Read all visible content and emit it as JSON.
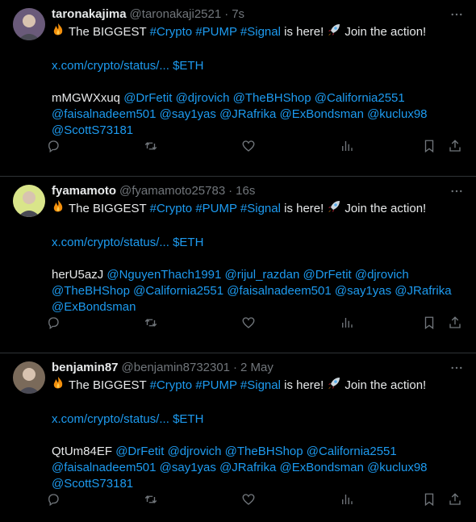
{
  "tweets": [
    {
      "name": "taronakajima",
      "handle": "@taronakaji2521",
      "time": "7s",
      "text_before": "The BIGGEST",
      "tags": [
        "#Crypto",
        "#PUMP",
        "#Signal"
      ],
      "text_after": "is here!",
      "text_end": "Join the action!",
      "link": "x.com/crypto/status/...",
      "cashtag": "$ETH",
      "code": "mMGWXxuq",
      "mentions_line1": "@DrFetit @djrovich @TheBHShop @California2551",
      "mentions_line2": "@faisalnadeem501 @say1yas @JRafrika @ExBondsman @kuclux98",
      "mentions_line3": "@ScottS73181",
      "avatar_color": "#6a5a7a"
    },
    {
      "name": "fyamamoto",
      "handle": "@fyamamoto25783",
      "time": "16s",
      "text_before": "The BIGGEST",
      "tags": [
        "#Crypto",
        "#PUMP",
        "#Signal"
      ],
      "text_after": "is here!",
      "text_end": "Join the action!",
      "link": "x.com/crypto/status/...",
      "cashtag": "$ETH",
      "code": "herU5azJ",
      "mentions_line1": "@NguyenThach1991 @rijul_razdan @DrFetit @djrovich",
      "mentions_line2": "@TheBHShop @California2551 @faisalnadeem501 @say1yas @JRafrika",
      "mentions_line3": "@ExBondsman",
      "avatar_color": "#d9e58a"
    },
    {
      "name": "benjamin87",
      "handle": "@benjamin8732301",
      "time": "2 May",
      "text_before": "The BIGGEST",
      "tags": [
        "#Crypto",
        "#PUMP",
        "#Signal"
      ],
      "text_after": "is here!",
      "text_end": "Join the action!",
      "link": "x.com/crypto/status/...",
      "cashtag": "$ETH",
      "code": "QtUm84EF",
      "mentions_line1": "@DrFetit @djrovich @TheBHShop @California2551",
      "mentions_line2": "@faisalnadeem501 @say1yas @JRafrika @ExBondsman @kuclux98",
      "mentions_line3": "@ScottS73181",
      "avatar_color": "#7a6a5a"
    }
  ],
  "icons": {
    "emoji1": "fire-emoji",
    "emoji2": "rocket-emoji",
    "more": "more-icon",
    "reply": "reply-icon",
    "retweet": "retweet-icon",
    "like": "like-icon",
    "views": "views-icon",
    "bookmark": "bookmark-icon",
    "share": "share-icon"
  },
  "colors": {
    "background": "#000000",
    "text": "#e7e9ea",
    "muted": "#71767b",
    "accent": "#1d9bf0",
    "divider": "#2f3336"
  }
}
